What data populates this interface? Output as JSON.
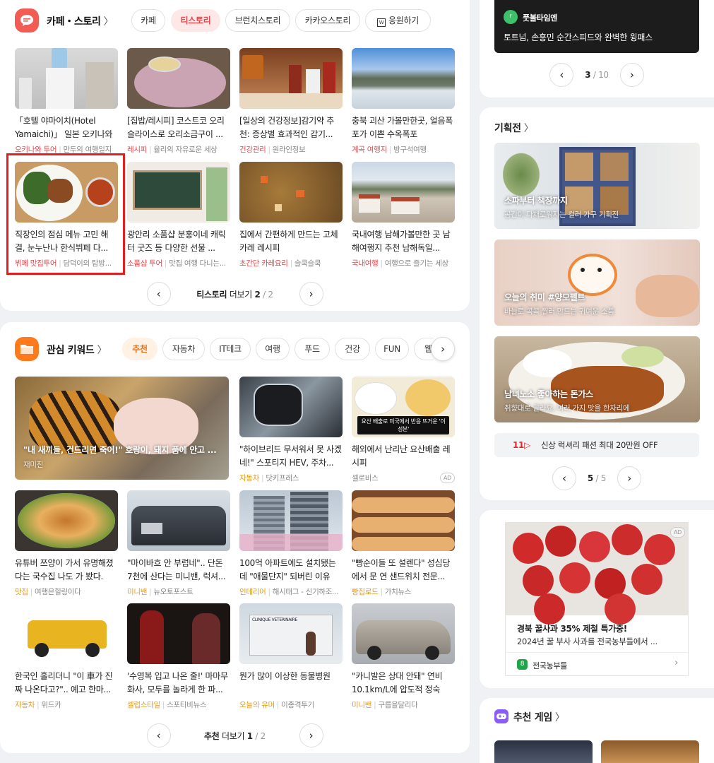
{
  "cafe": {
    "title": "카페・스토리",
    "tabs": [
      "카페",
      "티스토리",
      "브런치스토리",
      "카카오스토리",
      "응원하기"
    ],
    "items": [
      {
        "title": "「호텔 야마이치(Hotel Yamaichi)」 일본 오키나와 ...",
        "cat": "오키나와 투어",
        "src": "만두의 여행일지"
      },
      {
        "title": "[집밥/레시피] 코스트코 오리슬라이스로 오리소금구이 ...",
        "cat": "레시피",
        "src": "율리의 자유로운 세상"
      },
      {
        "title": "[일상의 건강정보]감기약 추천: 증상별 효과적인 감기...",
        "cat": "건강관리",
        "src": "원라인정보"
      },
      {
        "title": "충북 괴산 가볼만한곳, 얼음폭포가 이쁜 수옥폭포",
        "cat": "계곡 여행지",
        "src": "방구석여행"
      },
      {
        "title": "직장인의 점심 메뉴 고민 해결, 눈누난나 한식뷔페 다...",
        "cat": "뷔페 맛집투어",
        "src": "담덕이의 탐방..."
      },
      {
        "title": "광안리 소품샵 분홍이네 캐릭터 굿즈 등 다양한 선물 ...",
        "cat": "소품샵 투어",
        "src": "맛집 여행 다니는..."
      },
      {
        "title": "집에서 간편하게 만드는 고체카레 레시피",
        "cat": "초간단 카레요리",
        "src": "슬쿡슬쿡"
      },
      {
        "title": "국내여행 남해가볼만한 곳 남해여행지 추천 남해독일...",
        "cat": "국내여행",
        "src": "여행으로 즐기는 세상"
      }
    ],
    "pager": {
      "label": "티스토리",
      "more": "더보기",
      "cur": "2",
      "sep": "/",
      "total": "2"
    }
  },
  "keyword": {
    "title": "관심 키워드",
    "tabs": [
      "추천",
      "자동차",
      "IT테크",
      "여행",
      "푸드",
      "건강",
      "FUN",
      "웹"
    ],
    "big": {
      "title": "\"내 새끼들, 건드리면 죽어!\" 호랑이, 돼지 품에 안고 ...",
      "src": "재미진"
    },
    "items": [
      {
        "title": "\"하이브리드 무서워서 못 사겠네!\" 스포티지 HEV, 주차...",
        "cat": "자동차",
        "src": "닷키프레스"
      },
      {
        "title": "해외에서 난리난 요산배출 레시피",
        "cat": "",
        "src": "셀로비스",
        "ad": "AD"
      },
      {
        "title": "유튜버 쯔양이 가서 유명해졌다는 국수집 나도 가 봤다.",
        "cat": "맛집",
        "src": "여행은힐링이다"
      },
      {
        "title": "\"마이바흐 안 부럽네\".. 단돈 7천에 산다는 미니밴, 럭셔...",
        "cat": "미니밴",
        "src": "뉴오토포스트"
      },
      {
        "title": "100억 아파트에도 설치됐는데 \"애물단지\" 되버린 이유",
        "cat": "인테리어",
        "src": "해시태그 - 신기하조..."
      },
      {
        "title": "\"빵순이들 또 설렌다\" 성심당에서 문 연 샌드위치 전문...",
        "cat": "빵집로드",
        "src": "가치뉴스"
      },
      {
        "title": "한국인 홀리더니 \"이 車가 진짜 나온다고?\".. 예고 한마...",
        "cat": "자동차",
        "src": "위드카"
      },
      {
        "title": "'수영복 입고 나온 줄!' 마마무 화사, 모두를 놀라게 한 파...",
        "cat": "셀럽스타일",
        "src": "스포티비뉴스"
      },
      {
        "title": "뭔가 많이 이상한 동물병원",
        "cat": "오늘의 유머",
        "src": "이종격투기"
      },
      {
        "title": "\"카니발은 상대 안돼\" 연비 10.1km/L에 압도적 정숙성...",
        "cat": "미니밴",
        "src": "구름을달리다"
      }
    ],
    "thumb_text": "요산 배출로 미국에서 반응 뜨거운 '이 성분'",
    "clinic": "CLINIQUE VETERINAIRE",
    "pager": {
      "label": "추천",
      "more": "더보기",
      "cur": "1",
      "sep": "/",
      "total": "2"
    }
  },
  "sports": {
    "brand": "풋볼타임엔",
    "headline": "토트넘, 손흥민 순간스피드와 완벽한 윙패스",
    "cur": "3",
    "sep": "/",
    "total": "10"
  },
  "special": {
    "title": "기획전",
    "items": [
      {
        "title": "소파부터 책장까지",
        "sub": "공간이 다채로워지는 컬러 가구 기획전"
      },
      {
        "title": "오늘의 취미 #양모펠트",
        "sub": "바늘로 콕콕 찔러 만드는 귀여운 소품"
      },
      {
        "title": "남녀노소 좋아하는 돈가스",
        "sub": "취향대로 골라요, 여러 가지 맛을 한자리에"
      }
    ],
    "banner_logo": "11",
    "banner_text": "신상 럭셔리 패션 최대 20만원 OFF",
    "cur": "5",
    "sep": "/",
    "total": "5"
  },
  "ad": {
    "badge": "AD",
    "title": "경북 꿀사과 35% 제철 특가중!",
    "desc": "2024년 꿀 부사 사과를 전국농부들에서 ...",
    "brand": "전국농부들"
  },
  "game": {
    "title": "추천 게임"
  },
  "colors": {
    "accent": "#e8464b",
    "orange": "#ff7a1a",
    "red_frame": "#e02020"
  }
}
